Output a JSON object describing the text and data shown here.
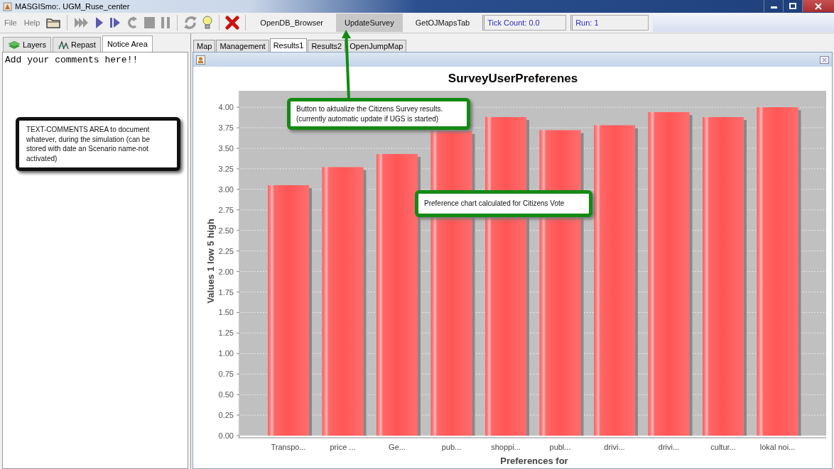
{
  "window": {
    "title": "MASGISmo:. UGM_Ruse_center"
  },
  "menu": [
    "File",
    "Help"
  ],
  "toolbar_buttons": [
    {
      "label": "OpenDB_Browser",
      "selected": false
    },
    {
      "label": "UpdateSurvey",
      "selected": true
    },
    {
      "label": "GetOJMapsTab",
      "selected": false
    }
  ],
  "status_fields": [
    "Tick Count: 0.0",
    "Run: 1"
  ],
  "left_tabs": [
    {
      "label": "Layers",
      "selected": false,
      "kind": "layers"
    },
    {
      "label": "Repast",
      "selected": false,
      "kind": "repast"
    },
    {
      "label": "Notice Area",
      "selected": true,
      "kind": "plain"
    }
  ],
  "notice_area": {
    "value": "Add your comments here!!"
  },
  "right_tabs": [
    {
      "label": "Map",
      "selected": false
    },
    {
      "label": "Management",
      "selected": false
    },
    {
      "label": "Results1",
      "selected": true
    },
    {
      "label": "Results2",
      "selected": false
    },
    {
      "label": "OpenJumpMap",
      "selected": false
    }
  ],
  "chart_data": {
    "type": "bar",
    "title": "SurveyUserPreferenes",
    "xlabel": "Preferences for",
    "ylabel": "Values 1 low 5 high",
    "categories": [
      "Transpo...",
      "price ...",
      "Ge...",
      "pub...",
      "shoppi...",
      "publ...",
      "drivi...",
      "drivi...",
      "cultur...",
      "lokal noi..."
    ],
    "grid": true,
    "series": [
      {
        "color": "#ff5555",
        "values": [
          3.05,
          3.27,
          3.43,
          3.71,
          3.88,
          3.72,
          3.78,
          3.94,
          3.88,
          4.0
        ]
      }
    ],
    "ylim": [
      0,
      4.2
    ],
    "yticks": [
      {
        "value": 0,
        "label": "0.00"
      },
      {
        "value": 0.25,
        "label": "0.25"
      },
      {
        "value": 0.5,
        "label": "0.50"
      },
      {
        "value": 0.75,
        "label": "0.75"
      },
      {
        "value": 1,
        "label": "1.00"
      },
      {
        "value": 1.25,
        "label": "1.25"
      },
      {
        "value": 1.5,
        "label": "1.50"
      },
      {
        "value": 1.75,
        "label": "1.75"
      },
      {
        "value": 2,
        "label": "2.00"
      },
      {
        "value": 2.25,
        "label": "2.25"
      },
      {
        "value": 2.5,
        "label": "2.50"
      },
      {
        "value": 2.75,
        "label": "2.75"
      },
      {
        "value": 3,
        "label": "3.00"
      },
      {
        "value": 3.25,
        "label": "3.25"
      },
      {
        "value": 3.5,
        "label": "3.50"
      },
      {
        "value": 3.75,
        "label": "3.75"
      },
      {
        "value": 4,
        "label": "4.00"
      }
    ]
  },
  "callouts": [
    {
      "kind": "dark",
      "text": "TEXT-COMMENTS AREA to document whatever, during the simulation (can be stored with date an Scenario name-not activated)"
    },
    {
      "kind": "green-arrow",
      "text": "Button to aktualize the Citizens Survey results.\n(currently automatic update if UGS is started)"
    },
    {
      "kind": "green",
      "text": "Preference chart calculated for Citizens Vote"
    }
  ]
}
